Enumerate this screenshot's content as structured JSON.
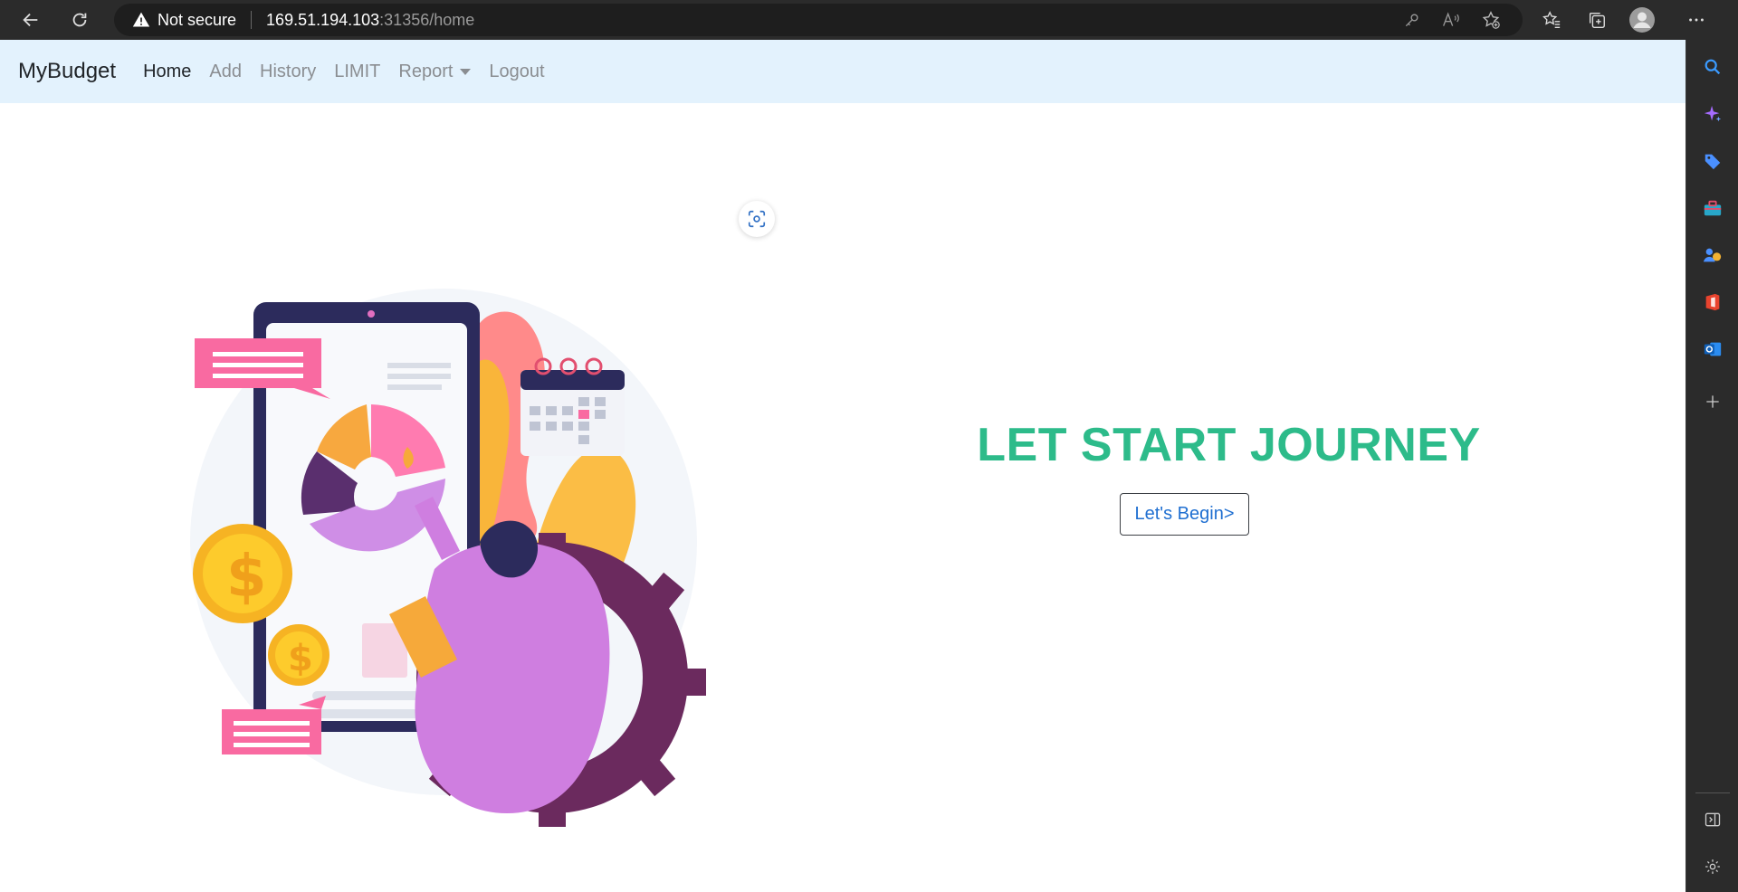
{
  "browser": {
    "security_label": "Not secure",
    "url_host": "169.51.194.103",
    "url_rest": ":31356/home"
  },
  "navbar": {
    "brand": "MyBudget",
    "links": [
      {
        "label": "Home",
        "active": true
      },
      {
        "label": "Add"
      },
      {
        "label": "History"
      },
      {
        "label": "LIMIT"
      },
      {
        "label": "Report"
      },
      {
        "label": "Logout"
      }
    ]
  },
  "hero": {
    "title": "LET START JOURNEY",
    "button_label": "Let's Begin>"
  },
  "colors": {
    "navbar_bg": "#e3f2fd",
    "title": "#2dbb8a",
    "button_text": "#1f6fd1",
    "chrome_bg": "#2b2b2b"
  }
}
